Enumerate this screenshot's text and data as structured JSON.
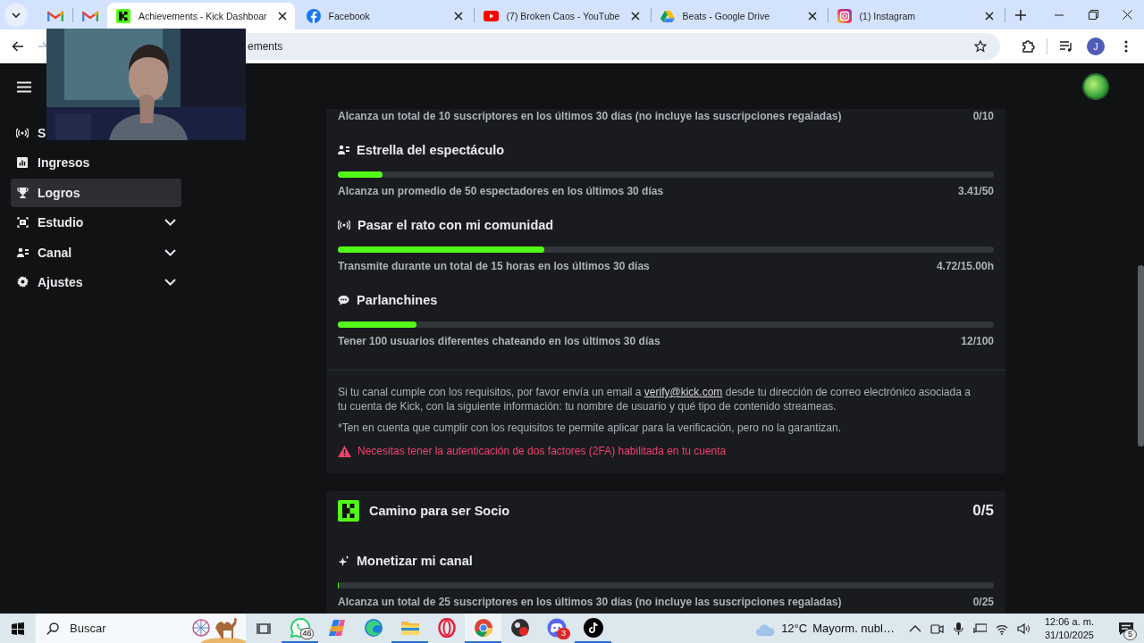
{
  "browser": {
    "tabs": [
      {
        "kind": "pinned",
        "selected": false
      },
      {
        "kind": "pinned",
        "selected": false
      },
      {
        "kind": "normal",
        "title": "Achievements - Kick Dashboar",
        "selected": true
      },
      {
        "kind": "normal",
        "title": "Facebook",
        "selected": false
      },
      {
        "kind": "normal",
        "title": "(7) Broken Caos - YouTube",
        "selected": false
      },
      {
        "kind": "normal",
        "title": "Beats - Google Drive",
        "selected": false
      },
      {
        "kind": "normal",
        "title": "(1) Instagram",
        "selected": false
      }
    ],
    "navigation": {
      "back_disabled": false,
      "forward_disabled": true
    },
    "address": {
      "value": "ements"
    },
    "profile_initial": "J"
  },
  "sidebar": {
    "items": [
      {
        "label": "S",
        "kind": "link",
        "selected": false
      },
      {
        "label": "Ingresos",
        "kind": "link",
        "selected": false
      },
      {
        "label": "Logros",
        "kind": "link",
        "selected": true
      },
      {
        "label": "Estudio",
        "kind": "group",
        "expanded": false,
        "selected": false
      },
      {
        "label": "Canal",
        "kind": "group",
        "expanded": false,
        "selected": false
      },
      {
        "label": "Ajustes",
        "kind": "group",
        "expanded": false,
        "selected": false
      }
    ]
  },
  "cards": [
    {
      "items": [
        {
          "description": "Alcanza un total de 10 suscriptores en los últimos 30 días (no incluye las suscripciones regaladas)",
          "value": "0/10"
        },
        {
          "title": "Estrella del espectáculo",
          "level": 0.068,
          "description": "Alcanza un promedio de 50 espectadores en los últimos 30 días",
          "value": "3.41/50"
        },
        {
          "title": "Pasar el rato con mi comunidad",
          "level": 0.315,
          "description": "Transmite durante un total de 15 horas en los últimos 30 días",
          "value": "4.72/15.00h"
        },
        {
          "title": "Parlanchines",
          "level": 0.12,
          "description": "Tener 100 usuarios diferentes chateando en los últimos 30 días",
          "value": "12/100"
        }
      ],
      "info": {
        "text_before": "Si tu canal cumple con los requisitos, por favor envía un email a ",
        "link": "verify@kick.com",
        "text_after": " desde tu dirección de correo electrónico asociada a tu cuenta de Kick, con la siguiente información: tu nombre de usuario y qué tipo de contenido streameas.",
        "note": "*Ten en cuenta que cumplir con los requisitos te permite aplicar para la verificación, pero no la garantizan.",
        "warning": "Necesitas tener la autenticación de dos factores (2FA) habilitada en tu cuenta"
      }
    },
    {
      "title": "Camino para ser Socio",
      "count": "0/5",
      "items": [
        {
          "title": "Monetizar mi canal",
          "level": 0,
          "description": "Alcanza un total de 25 suscriptores en los últimos 30 días (no incluye las suscripciones regaladas)",
          "value": "0/25"
        }
      ]
    }
  ],
  "taskbar": {
    "search": {
      "placeholder": "Buscar"
    },
    "apps": [
      {
        "badge": "46",
        "running": true,
        "selected": false
      },
      {
        "running": false,
        "selected": false
      },
      {
        "running": false,
        "selected": false
      },
      {
        "running": true,
        "selected": false
      },
      {
        "running": false,
        "selected": false
      },
      {
        "running": true,
        "selected": true
      },
      {
        "running": false,
        "selected": false
      },
      {
        "badge": "3",
        "running": false,
        "selected": false
      },
      {
        "running": true,
        "selected": false
      }
    ],
    "weather": {
      "temperature": "12°C",
      "condition": "Mayorm. nubl…"
    },
    "clock": {
      "time": "12:06 a. m.",
      "date": "31/10/2025"
    },
    "notifications": {
      "count": "5"
    }
  }
}
